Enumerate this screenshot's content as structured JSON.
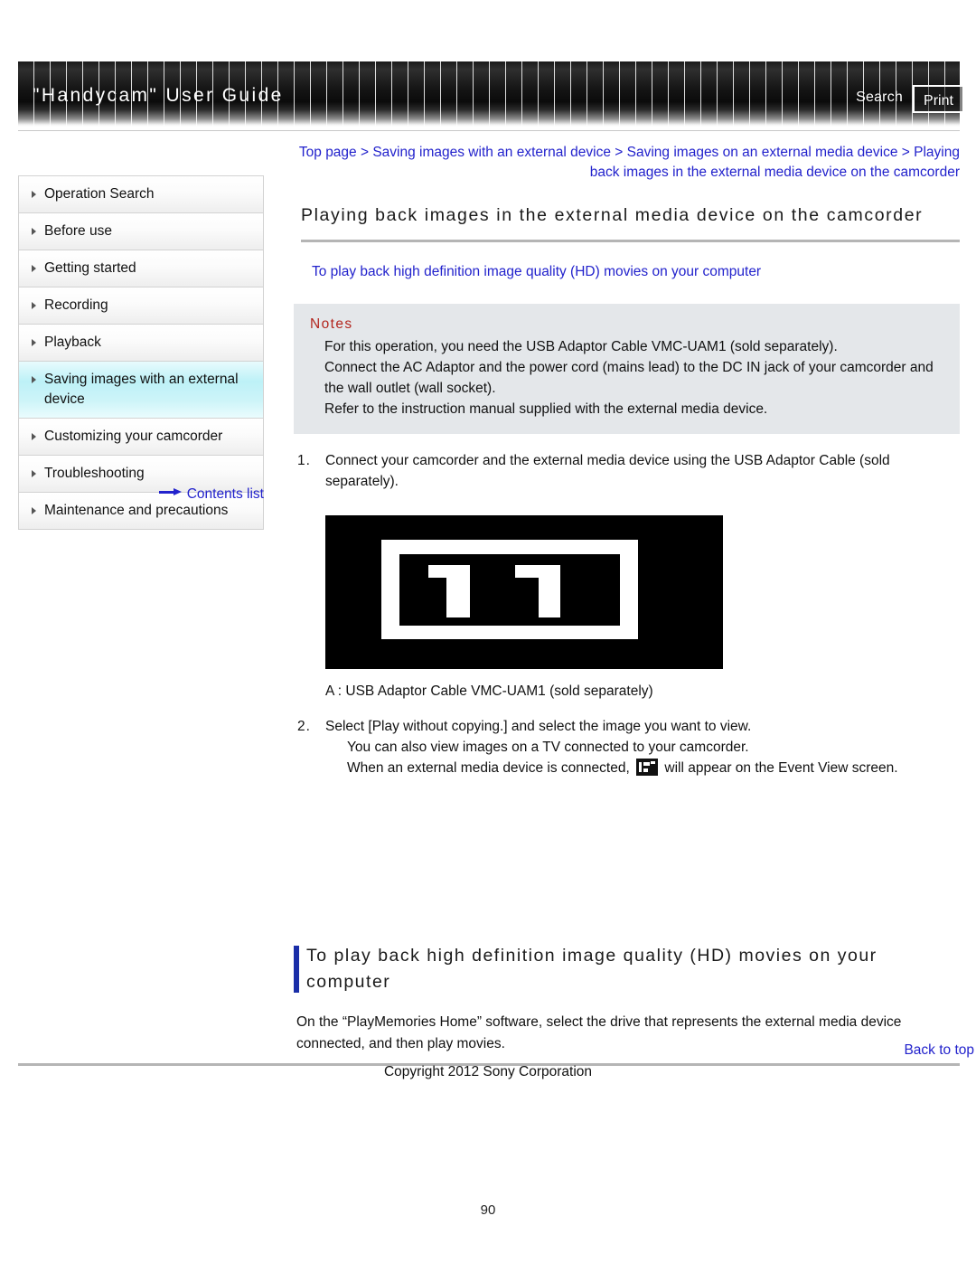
{
  "header": {
    "site_title": "\"Handycam\" User Guide",
    "search_label": "Search",
    "print_label": "Print"
  },
  "sidebar": {
    "items": [
      {
        "label": "Operation Search",
        "active": false
      },
      {
        "label": "Before use",
        "active": false
      },
      {
        "label": "Getting started",
        "active": false
      },
      {
        "label": "Recording",
        "active": false
      },
      {
        "label": "Playback",
        "active": false
      },
      {
        "label": "Saving images with an external device",
        "active": true
      },
      {
        "label": "Customizing your camcorder",
        "active": false
      },
      {
        "label": "Troubleshooting",
        "active": false
      },
      {
        "label": "Maintenance and precautions",
        "active": false
      }
    ],
    "contents_list_label": "Contents list"
  },
  "main": {
    "breadcrumb": "Top page > Saving images with an external device > Saving images on an external media device > Playing back images in the external media device on the camcorder",
    "page_title": "Playing back images in the external media device on the camcorder",
    "anchor_link": "To play back high definition image quality (HD) movies on your computer",
    "notes": {
      "heading": "Notes",
      "lines": [
        "For this operation, you need the USB Adaptor Cable VMC-UAM1 (sold separately).",
        "Connect the AC Adaptor and the power cord (mains lead) to the DC IN jack of your camcorder and the wall outlet (wall socket).",
        "Refer to the instruction manual supplied with the external media device."
      ]
    },
    "steps": [
      {
        "num": "1.",
        "text": "Connect your camcorder and the external media device using the USB Adaptor Cable (sold separately)."
      },
      {
        "num": "2.",
        "text": "Select [Play without copying.] and select the image you want to view.",
        "sub_lines": [
          "You can also view images on a TV connected to your camcorder.",
          "When an external media device is connected, ",
          " will appear on the Event View screen."
        ]
      }
    ],
    "figure_caption": "A : USB Adaptor Cable VMC-UAM1 (sold separately)",
    "section2": {
      "heading": "To play back high definition image quality (HD) movies on your computer",
      "body": "On the “PlayMemories Home” software, select the drive that represents the external media device connected, and then play movies."
    }
  },
  "footer": {
    "back_to_top": "Back to top",
    "copyright": "Copyright 2012 Sony Corporation",
    "page_number": "90"
  },
  "colors": {
    "link": "#2222cc",
    "notes_heading": "#b3261e",
    "section_bar": "#1a2ea8",
    "notes_bg": "#e4e7ea",
    "active_nav": "#bdf1f7"
  }
}
